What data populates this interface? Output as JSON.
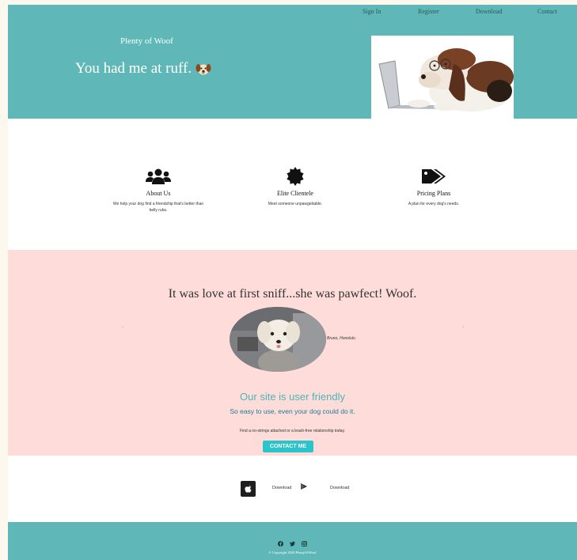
{
  "nav": {
    "items": [
      {
        "label": "Sign In"
      },
      {
        "label": "Register"
      },
      {
        "label": "Download"
      },
      {
        "label": "Contact"
      }
    ]
  },
  "hero": {
    "brand": "Plenty of Woof",
    "tagline": "You had me at ruff.",
    "tagline_icon": "dog-face-emoji",
    "photo_icon": "basset-hound-with-laptop-photo"
  },
  "features": [
    {
      "icon": "users-icon",
      "title": "About Us",
      "description": "We help your dog find a friendship that's better than belly rubs."
    },
    {
      "icon": "certificate-icon",
      "title": "Elite Clientele",
      "description": "Meet someone unpawgettable."
    },
    {
      "icon": "tags-icon",
      "title": "Pricing Plans",
      "description": "A plan for every dog's needs."
    }
  ],
  "testimonial": {
    "quote": "It was love at first sniff...she was pawfect! Woof.",
    "caption": "Bruno, Honolulu",
    "prev_glyph": "‹",
    "next_glyph": "›"
  },
  "friendly": {
    "title": "Our site is user friendly",
    "subtitle": "So easy to use, even your dog could do it.",
    "text": "Find a no-strings attached or a leash-free relationship today."
  },
  "contact": {
    "label": "CONTACT ME"
  },
  "download": {
    "apple_label": "Download",
    "google_label": "Download"
  },
  "footer": {
    "social_icons": [
      "facebook-icon",
      "twitter-icon",
      "instagram-icon"
    ],
    "copyright": "© Copyright 2020 PlentyOfWoof"
  },
  "colors": {
    "teal": "#5fb8b7",
    "pink": "#fddcda",
    "button": "#2cc4cb",
    "heading_teal": "#4fb4b6"
  }
}
